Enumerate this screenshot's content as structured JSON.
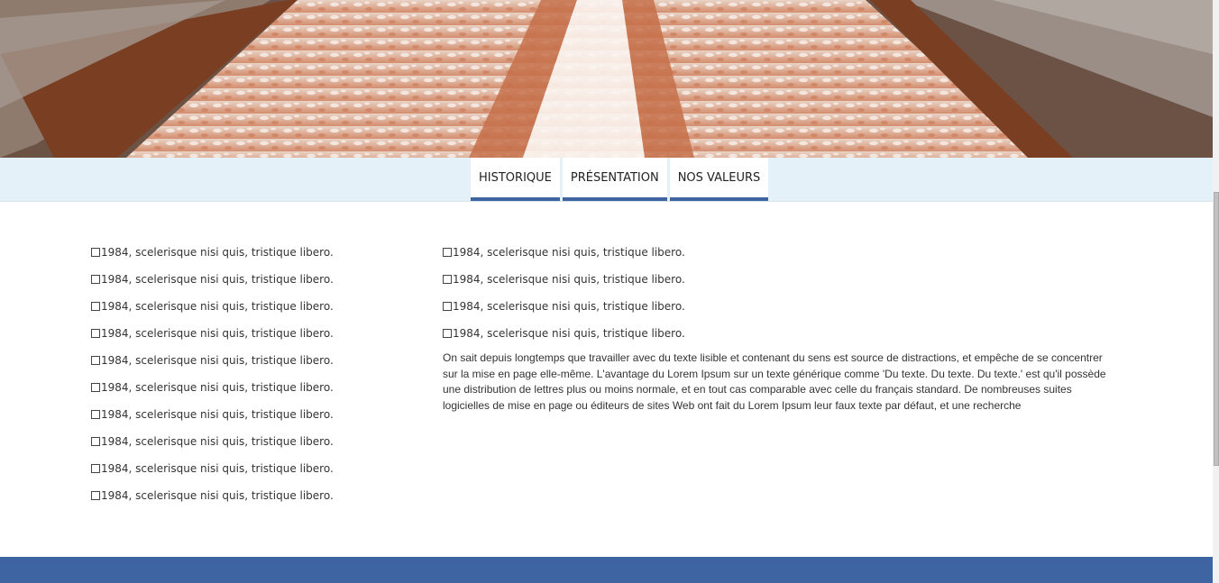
{
  "tabs": [
    {
      "label": "HISTORIQUE"
    },
    {
      "label": "PRÉSENTATION"
    },
    {
      "label": "NOS VALEURS"
    }
  ],
  "left_list": [
    "1984, scelerisque nisi quis, tristique libero.",
    "1984, scelerisque nisi quis, tristique libero.",
    "1984, scelerisque nisi quis, tristique libero.",
    "1984, scelerisque nisi quis, tristique libero.",
    "1984, scelerisque nisi quis, tristique libero.",
    "1984, scelerisque nisi quis, tristique libero.",
    "1984, scelerisque nisi quis, tristique libero.",
    "1984, scelerisque nisi quis, tristique libero.",
    "1984, scelerisque nisi quis, tristique libero.",
    "1984, scelerisque nisi quis, tristique libero."
  ],
  "right_list": [
    "1984, scelerisque nisi quis, tristique libero.",
    "1984, scelerisque nisi quis, tristique libero.",
    "1984, scelerisque nisi quis, tristique libero.",
    "1984, scelerisque nisi quis, tristique libero."
  ],
  "paragraph": "On sait depuis longtemps que travailler avec du texte lisible et contenant du sens est source de distractions, et empêche de se concentrer sur la mise en page elle-même. L'avantage du Lorem Ipsum sur un texte générique comme 'Du texte. Du texte. Du texte.' est qu'il possède une distribution de lettres plus ou moins normale, et en tout cas comparable avec celle du français standard. De nombreuses suites logicielles de mise en page ou éditeurs de sites Web ont fait du Lorem Ipsum leur faux texte par défaut, et une recherche",
  "colors": {
    "accent": "#3e64a1",
    "tabbar_bg": "#e5f1f8"
  }
}
